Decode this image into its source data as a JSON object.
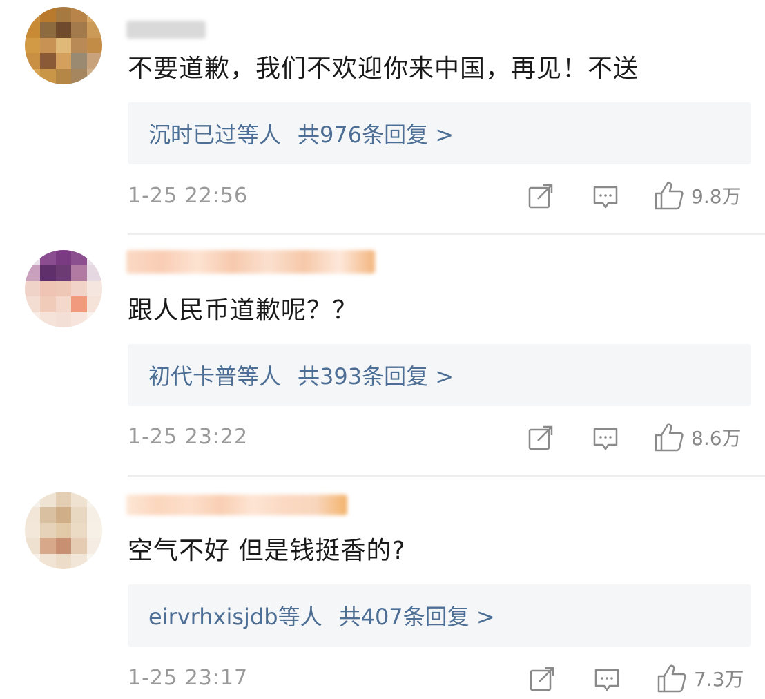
{
  "comments": [
    {
      "username": "",
      "text": "不要道歉，我们不欢迎你来中国，再见！不送",
      "reply_summary": {
        "users": "沉时已过等人",
        "count_text": "共976条回复 >"
      },
      "timestamp": "1-25 22:56",
      "likes": "9.8万"
    },
    {
      "username": "",
      "text": "跟人民币道歉呢？？",
      "reply_summary": {
        "users": "初代卡普等人",
        "count_text": "共393条回复 >"
      },
      "timestamp": "1-25 23:22",
      "likes": "8.6万"
    },
    {
      "username": "",
      "text": "空气不好 但是钱挺香的?",
      "reply_summary": {
        "users": "eirvrhxisjdb等人",
        "count_text": "共407条回复 >"
      },
      "timestamp": "1-25 23:17",
      "likes": "7.3万"
    }
  ],
  "icons": {
    "share": "share-icon",
    "comment": "comment-icon",
    "like": "thumbs-up-icon"
  },
  "colors": {
    "link": "#4d6e95",
    "meta": "#9a9a9a",
    "reply_bg": "#f5f6f8"
  }
}
